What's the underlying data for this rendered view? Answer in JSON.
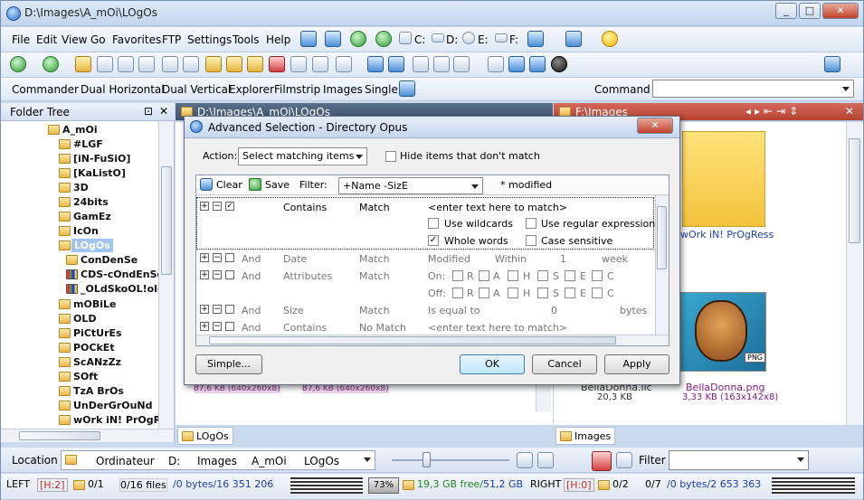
{
  "window": {
    "title": "D:\\Images\\A_mOi\\LOgOs",
    "btn_min": "_",
    "btn_max": "□",
    "btn_close": "✕"
  },
  "menu": [
    "File",
    "Edit",
    "View",
    "Go",
    "Favorites",
    "FTP",
    "Settings",
    "Tools",
    "Help"
  ],
  "drives": [
    "C:",
    "D:",
    "E:",
    "F:"
  ],
  "layouts": [
    "Commander",
    "Dual Horizontal",
    "Dual Vertical",
    "Explorer",
    "Filmstrip",
    "Images",
    "Single"
  ],
  "command_label": "Command",
  "folder_tree": {
    "title": "Folder Tree",
    "pin": "⊡",
    "close": "✕",
    "items": [
      "A_mOi",
      "#LGF",
      "[iN-FuSiO]",
      "[KaListO]",
      "3D",
      "24bits",
      "GamEz",
      "IcOn",
      "LOgOs",
      "ConDenSe",
      "CDS-cOndEnSe",
      "_OLdSkoOL!old",
      "mOBiLe",
      "OLD",
      "PiCtUrEs",
      "POCkEt",
      "ScANzZz",
      "SOft",
      "TzA BrOs",
      "UnDerGrOuNd",
      "wOrk iN! PrOgRes"
    ]
  },
  "left_panel": {
    "path": "D:\\Images\\A_mOi\\LOgOs",
    "tab": "LOgOs",
    "file_a": "87,6 KB (640x260x8)",
    "file_b": "87,6 KB (640x260x8)"
  },
  "right_panel": {
    "path": "F:\\Images",
    "tab": "Images",
    "folder_label": "wOrk iN! PrOgRess",
    "file_name": "BellaDonna.png",
    "file_name_behind": "BellaDonna.lic",
    "file_size": "20,3 KB",
    "file_info": "3,33 KB (163x142x8)",
    "badge": "PNG"
  },
  "dialog": {
    "title": "Advanced Selection - Directory Opus",
    "close": "✕",
    "action_label": "Action:",
    "action_value": "Select matching items",
    "hide_label": "Hide items that don't match",
    "clear": "Clear",
    "save": "Save",
    "filter_label": "Filter:",
    "filter_value": "+Name -SizE",
    "modified": "* modified",
    "row1": {
      "field": "Contains",
      "op": "Match",
      "value": "<enter text here to match>",
      "opt1": "Use wildcards",
      "opt2": "Use regular expression",
      "opt3": "Whole words",
      "opt4": "Case sensitive"
    },
    "row2": {
      "join": "And",
      "field": "Date",
      "op": "Match",
      "a": "Modified",
      "b": "Within",
      "c": "1",
      "d": "week"
    },
    "row3": {
      "join": "And",
      "field": "Attributes",
      "op": "Match",
      "on": "On:",
      "off": "Off:",
      "attrs": [
        "R",
        "A",
        "H",
        "S",
        "E",
        "C"
      ]
    },
    "row4": {
      "join": "And",
      "field": "Size",
      "op": "Match",
      "a": "Is equal to",
      "b": "0",
      "c": "bytes"
    },
    "row5": {
      "join": "And",
      "field": "Contains",
      "op": "No Match",
      "value": "<enter text here to match>"
    },
    "simple": "Simple...",
    "ok": "OK",
    "cancel": "Cancel",
    "apply": "Apply"
  },
  "locbar": {
    "label": "Location",
    "crumbs": [
      "Ordinateur",
      "D:",
      "Images",
      "A_mOi",
      "LOgOs"
    ],
    "filter": "Filter"
  },
  "status": {
    "left": "LEFT",
    "lh": "[H:2]",
    "lfolders": "0/1",
    "lfiles": "0/16 files",
    "lbytes": "/0 bytes/16 351 206",
    "pct": "73%",
    "free": "19,3 GB free/",
    "total": "51,2 GB",
    "right": "RIGHT",
    "rh": "[H:0]",
    "rfolders": "0/2",
    "rfiles": "0/7",
    "rbytes": "/0 bytes/2 653 363"
  },
  "colors": {
    "accent": "#3c7fb1",
    "red": "#cc2b20",
    "green": "#1e8a1e",
    "blue": "#1d3fb0",
    "purple": "#8a1a8a"
  }
}
